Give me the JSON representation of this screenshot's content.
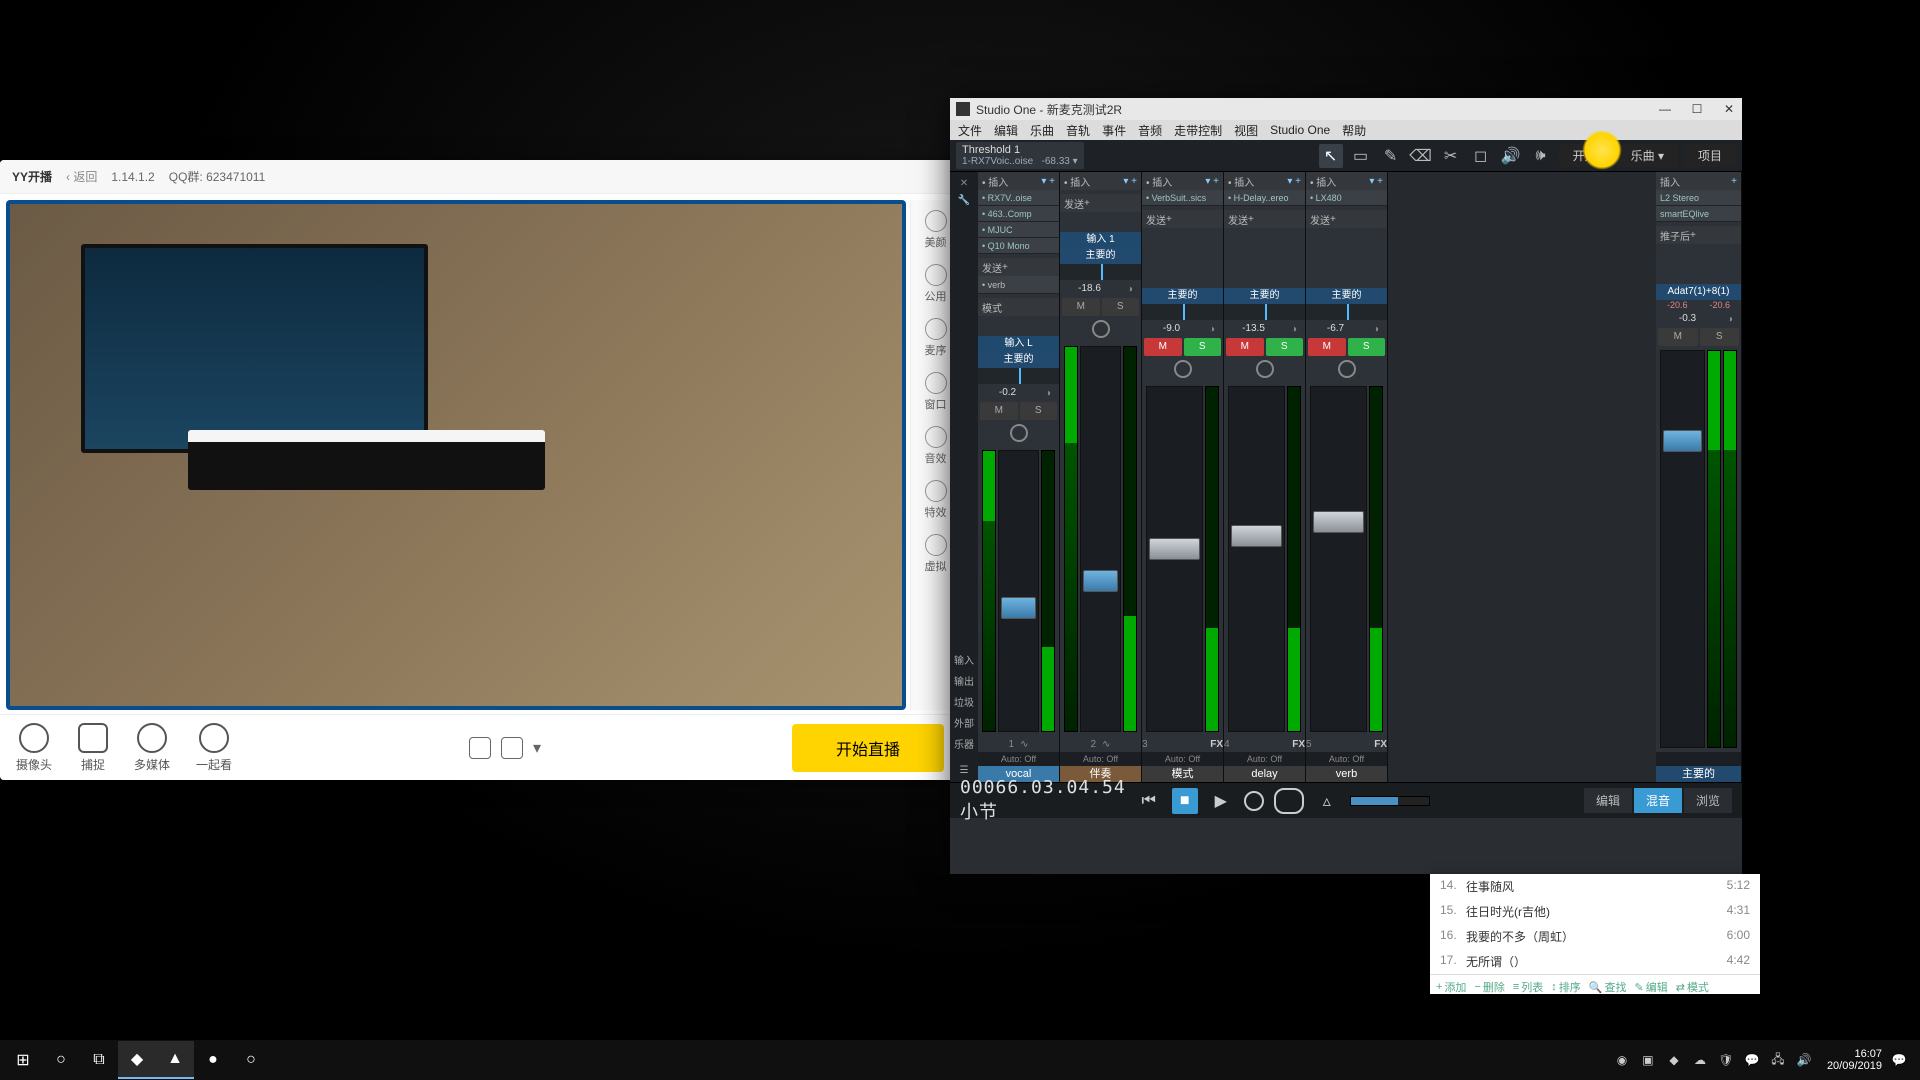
{
  "yy": {
    "logo": "YY开播",
    "back": "‹ 返回",
    "version": "1.14.1.2",
    "qq": "QQ群: 623471011",
    "side_items": [
      "美颜",
      "公用",
      "麦序",
      "窗口",
      "音效",
      "特效",
      "虚拟"
    ],
    "bottom_buttons": {
      "camera": "摄像头",
      "capture": "捕捉",
      "media": "多媒体",
      "together": "一起看"
    },
    "start": "开始直播"
  },
  "studio_one": {
    "title": "Studio One - 新麦克测试2R",
    "menu": [
      "文件",
      "编辑",
      "乐曲",
      "音轨",
      "事件",
      "音频",
      "走带控制",
      "视图",
      "Studio One",
      "帮助"
    ],
    "track_pill": {
      "name": "Threshold 1",
      "sub": "1-RX7Voic..oise",
      "db": "-68.33"
    },
    "right_buttons": {
      "start": "开始",
      "song": "乐曲",
      "project": "项目"
    },
    "insert_label": "插入",
    "send_label": "发送",
    "mode_label": "模式",
    "post_label": "推子后",
    "channels": [
      {
        "name": "vocal",
        "io": "输入 L",
        "main": "主要的",
        "db": "-0.2",
        "m": false,
        "s": false,
        "fader": 52,
        "nameClass": "vocal",
        "inserts": [
          "RX7V..oise",
          "463..Comp",
          "MJUC",
          "Q10 Mono"
        ]
      },
      {
        "name": "伴奏",
        "io": "输入 1",
        "main": "主要的",
        "db": "-18.6",
        "m": false,
        "s": false,
        "fader": 58,
        "nameClass": "bk",
        "inserts": []
      },
      {
        "name": "模式",
        "io": "",
        "main": "主要的",
        "db": "-9.0",
        "m": true,
        "s": true,
        "fader": 44,
        "nameClass": "fx",
        "fx": "FX",
        "inserts": [
          "VerbSuit..sics"
        ]
      },
      {
        "name": "delay",
        "io": "",
        "main": "主要的",
        "db": "-13.5",
        "m": true,
        "s": true,
        "fader": 40,
        "nameClass": "fx",
        "fx": "FX",
        "inserts": [
          "H-Delay..ereo"
        ]
      },
      {
        "name": "verb",
        "io": "",
        "main": "主要的",
        "db": "-6.7",
        "m": true,
        "s": true,
        "fader": 36,
        "nameClass": "fx",
        "fx": "FX",
        "inserts": [
          "LX480"
        ]
      }
    ],
    "master": {
      "name": "主要的",
      "io": "Adat7(1)+8(1)",
      "db": "-0.3",
      "m": false,
      "s": false,
      "fader": 20,
      "inserts": [
        "L2 Stereo",
        "smartEQlive"
      ],
      "clip": [
        "-20.6",
        "-20.6"
      ]
    },
    "left_tabs": [
      "输入",
      "输出",
      "垃圾",
      "外部",
      "乐器"
    ],
    "auto_off": "Auto: Off",
    "transport": {
      "time": "00066.03.04.54",
      "unit": "小节"
    },
    "right_tabs": {
      "edit": "编辑",
      "mix": "混音",
      "browse": "浏览"
    }
  },
  "playlist": {
    "items": [
      {
        "n": "14.",
        "t": "往事随风",
        "d": "5:12"
      },
      {
        "n": "15.",
        "t": "往日时光(r吉他)",
        "d": "4:31"
      },
      {
        "n": "16.",
        "t": "我要的不多（周虹）",
        "d": "6:00"
      },
      {
        "n": "17.",
        "t": "无所谓（）",
        "d": "4:42"
      }
    ],
    "footer": {
      "add": "添加",
      "del": "删除",
      "list": "列表",
      "sort": "排序",
      "find": "查找",
      "edit": "编辑",
      "mode": "模式"
    }
  },
  "taskbar": {
    "time": "16:07",
    "date": "20/09/2019"
  }
}
